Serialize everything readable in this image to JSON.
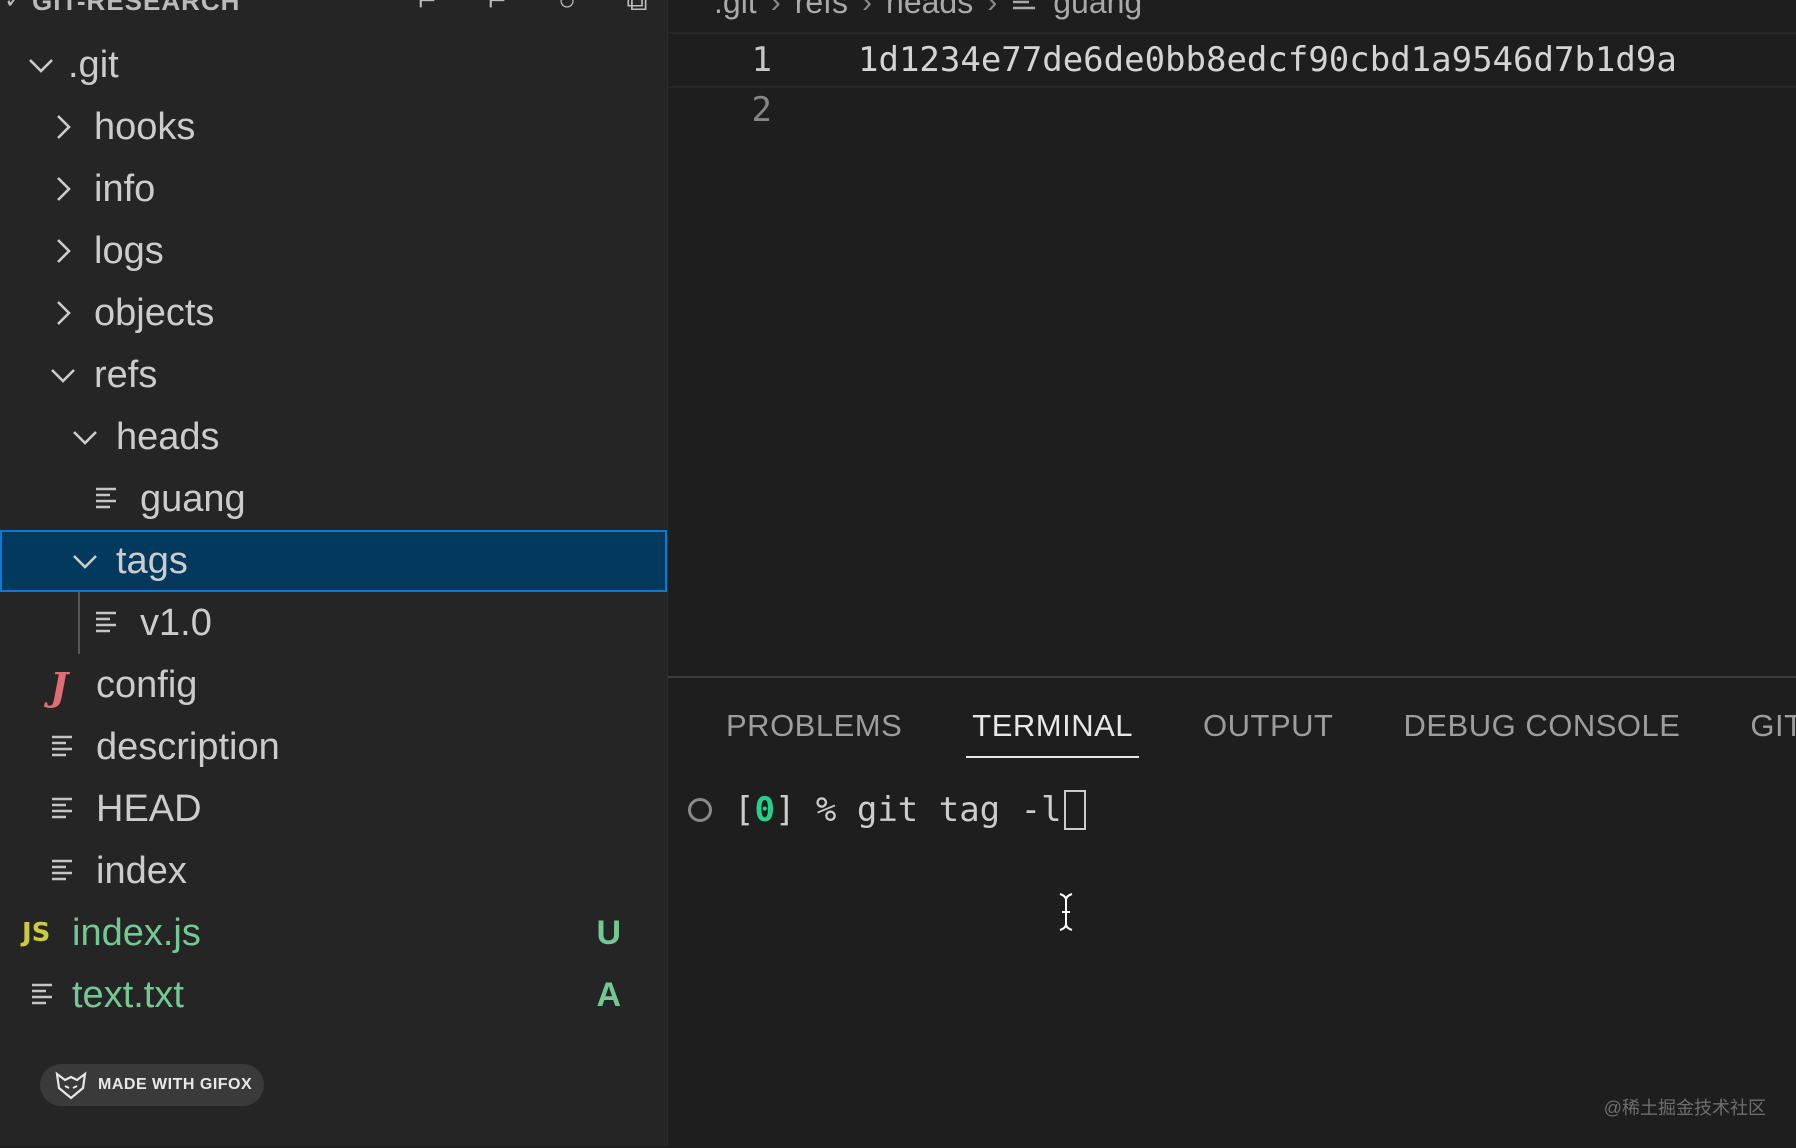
{
  "sidebar": {
    "title": "GIT-RESEARCH",
    "tree": [
      {
        "label": ".git",
        "kind": "folder-open"
      },
      {
        "label": "hooks",
        "kind": "folder-closed"
      },
      {
        "label": "info",
        "kind": "folder-closed"
      },
      {
        "label": "logs",
        "kind": "folder-closed"
      },
      {
        "label": "objects",
        "kind": "folder-closed"
      },
      {
        "label": "refs",
        "kind": "folder-open"
      },
      {
        "label": "heads",
        "kind": "folder-open"
      },
      {
        "label": "guang",
        "kind": "file"
      },
      {
        "label": "tags",
        "kind": "folder-open",
        "selected": true
      },
      {
        "label": "v1.0",
        "kind": "file"
      },
      {
        "label": "config",
        "kind": "file-j"
      },
      {
        "label": "description",
        "kind": "file"
      },
      {
        "label": "HEAD",
        "kind": "file"
      },
      {
        "label": "index",
        "kind": "file"
      },
      {
        "label": "index.js",
        "kind": "file-js",
        "badge": "U"
      },
      {
        "label": "text.txt",
        "kind": "file",
        "badge": "A"
      }
    ]
  },
  "gifox": {
    "label": "MADE WITH GIFOX"
  },
  "editor": {
    "breadcrumb": [
      ".git",
      "refs",
      "heads",
      "guang"
    ],
    "lines": [
      {
        "number": "1",
        "text": "1d1234e77de6de0bb8edcf90cbd1a9546d7b1d9a"
      },
      {
        "number": "2",
        "text": ""
      }
    ]
  },
  "panel": {
    "tabs": [
      "PROBLEMS",
      "TERMINAL",
      "OUTPUT",
      "DEBUG CONSOLE",
      "GIT"
    ],
    "active_tab": "TERMINAL",
    "terminal": {
      "prompt_open": "[",
      "exit_code": "0",
      "prompt_close": "] % ",
      "command": "git tag -l"
    }
  },
  "watermark": "@稀土掘金技术社区",
  "colors": {
    "selection_bg": "#04395e",
    "selection_border": "#0a7ad6",
    "git_green": "#73c991",
    "exit_code_green": "#23d18b"
  }
}
